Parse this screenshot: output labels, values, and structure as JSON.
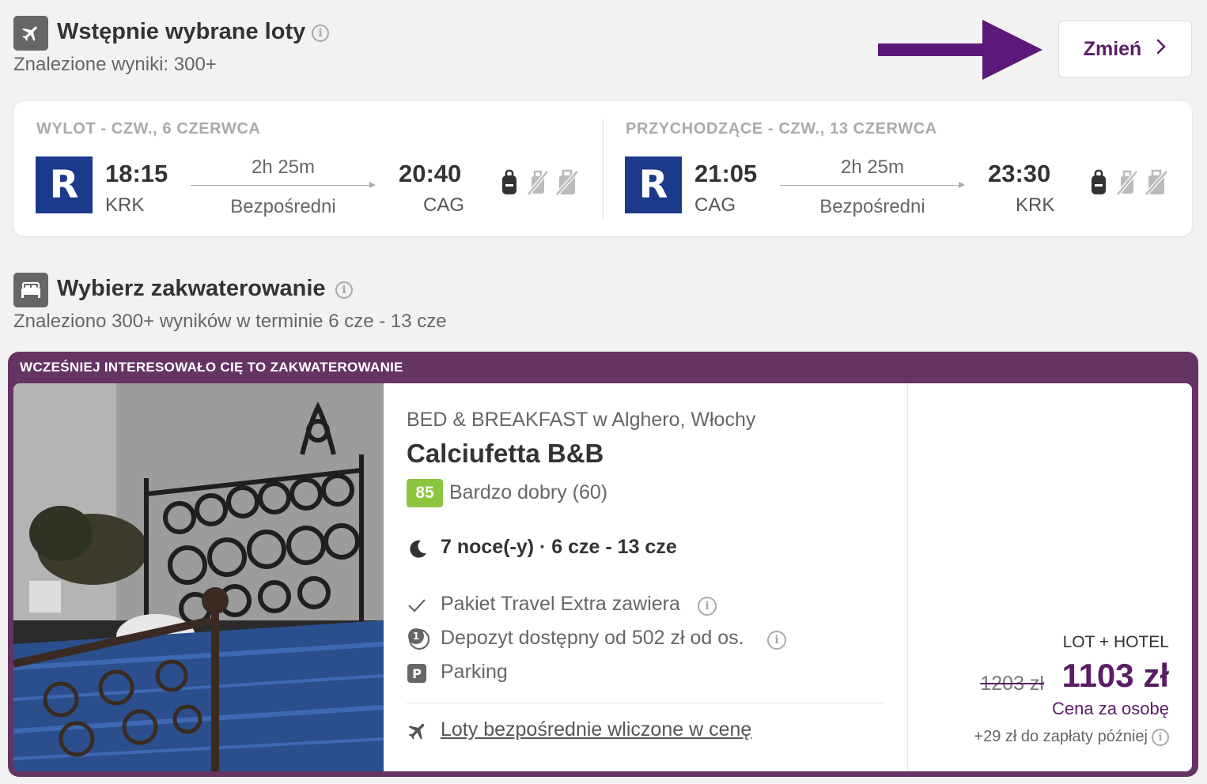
{
  "flights_section": {
    "title": "Wstępnie wybrane loty",
    "subtitle": "Znalezione wyniki: 300+",
    "change_label": "Zmień"
  },
  "outbound": {
    "header": "WYLOT - CZW., 6 CZERWCA",
    "airline": "R",
    "dep_time": "18:15",
    "dep_code": "KRK",
    "duration": "2h 25m",
    "stops": "Bezpośredni",
    "arr_time": "20:40",
    "arr_code": "CAG"
  },
  "inbound": {
    "header": "PRZYCHODZĄCE - CZW., 13 CZERWCA",
    "airline": "R",
    "dep_time": "21:05",
    "dep_code": "CAG",
    "duration": "2h 25m",
    "stops": "Bezpośredni",
    "arr_time": "23:30",
    "arr_code": "KRK"
  },
  "accommodation_section": {
    "title": "Wybierz zakwaterowanie",
    "subtitle": "Znaleziono 300+ wyników w terminie 6 cze - 13 cze"
  },
  "offer": {
    "banner": "WCZEŚNIEJ INTERESOWAŁO CIĘ TO ZAKWATEROWANIE",
    "type": "BED & BREAKFAST w Alghero, Włochy",
    "name": "Calciufetta B&B",
    "score": "85",
    "rating_text": "Bardzo dobry (60)",
    "nights": "7 noce(-y) · 6 cze - 13 cze",
    "features": [
      "Pakiet Travel Extra zawiera",
      "Depozyt dostępny od 502 zł od os.",
      "Parking"
    ],
    "flights_link": "Loty bezpośrednie wliczone w cenę",
    "package_label": "LOT + HOTEL",
    "old_price": "1203 zł",
    "price": "1103 zł",
    "per_person": "Cena za osobę",
    "pay_later": "+29 zł do zapłaty później"
  },
  "colors": {
    "brand_purple": "#5a1d66",
    "banner_purple": "#653462",
    "score_green": "#8cc63f",
    "airline_blue": "#1b3a8c"
  }
}
